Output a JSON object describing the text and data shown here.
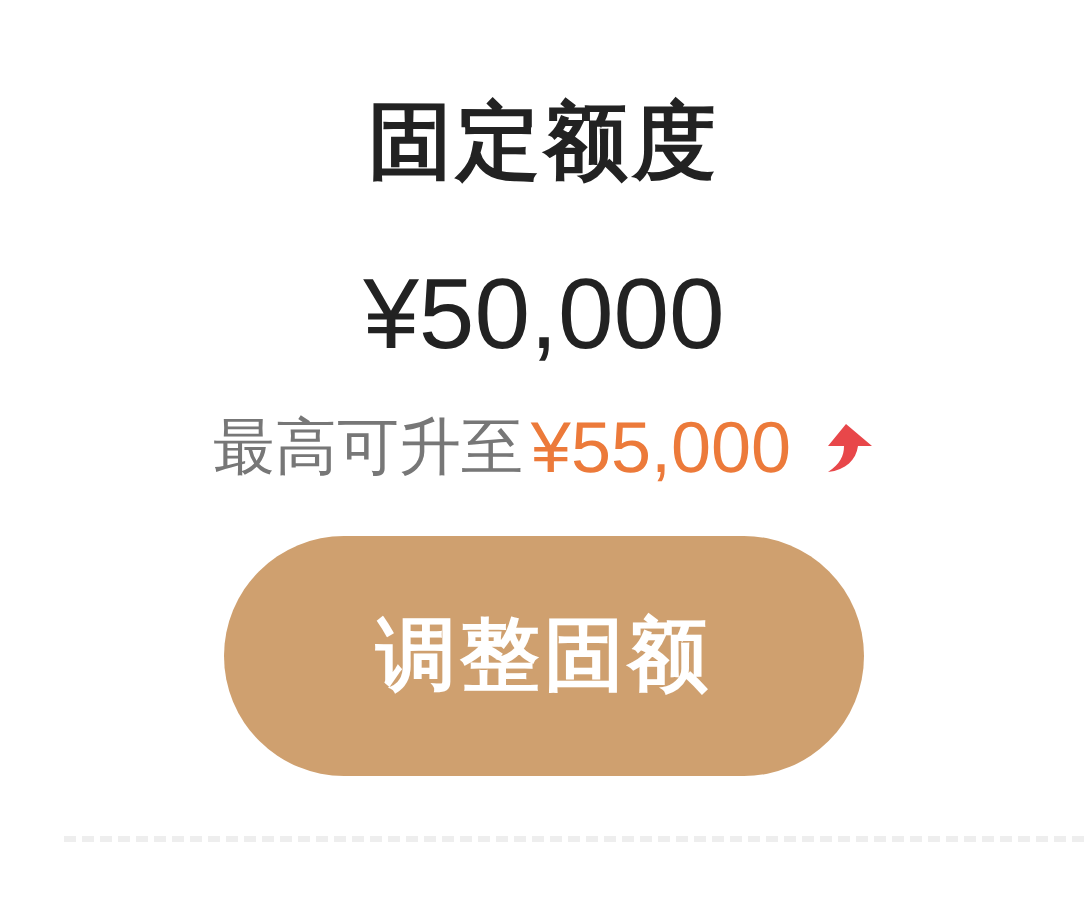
{
  "title": "固定额度",
  "amount": "¥50,000",
  "upgrade": {
    "label": "最高可升至",
    "amount": "¥55,000"
  },
  "button": "调整固额"
}
